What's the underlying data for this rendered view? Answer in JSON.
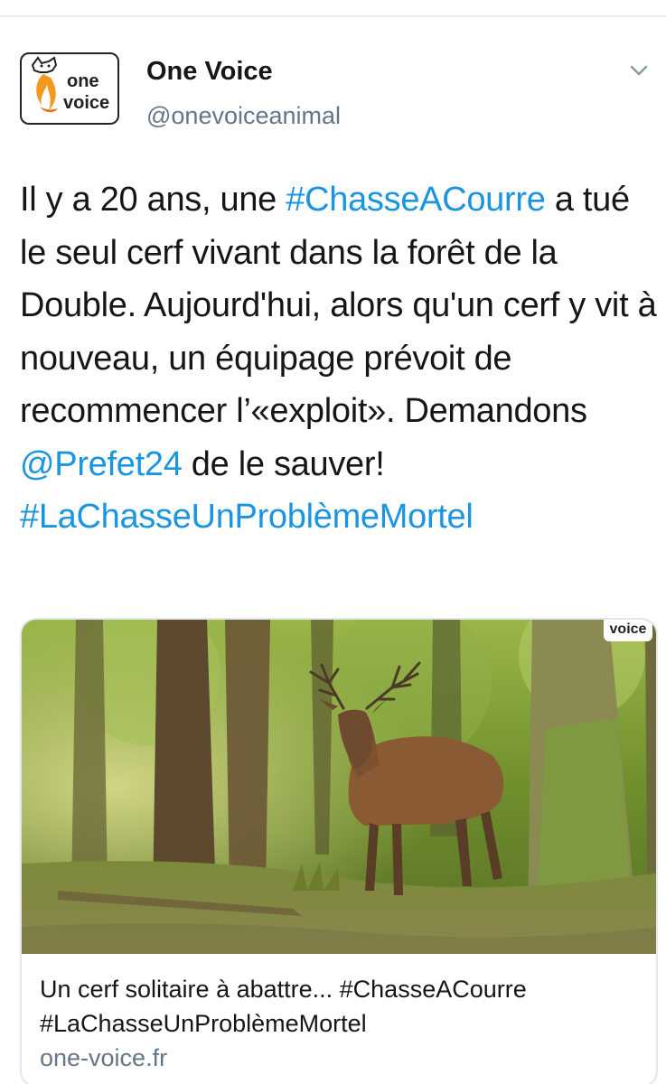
{
  "account": {
    "display_name": "One Voice",
    "handle": "@onevoiceanimal",
    "avatar_logo_text": "one voice",
    "menu_icon": "chevron-down-icon"
  },
  "tweet": {
    "segments": [
      {
        "text": "Il y a 20 ans, une ",
        "type": "text"
      },
      {
        "text": "#ChasseACourre",
        "type": "link"
      },
      {
        "text": " a tué le seul cerf vivant dans la forêt de la Double. Aujourd'hui, alors qu'un cerf y vit à nouveau, un équipage prévoit de recommencer l’«exploit». Demandons ",
        "type": "text"
      },
      {
        "text": "@Prefet24",
        "type": "link"
      },
      {
        "text": " de le sauver! ",
        "type": "text"
      },
      {
        "text": "#LaChasseUnProblèmeMortel",
        "type": "link"
      }
    ]
  },
  "card": {
    "image_badge": "voice",
    "title": "Un cerf solitaire à abattre... #ChasseACourre #LaChasseUnProblèmeMortel",
    "domain": "one-voice.fr"
  },
  "colors": {
    "link": "#1b95e0",
    "secondary_text": "#657786",
    "primary_text": "#14171a",
    "border": "#e1e8ed"
  }
}
